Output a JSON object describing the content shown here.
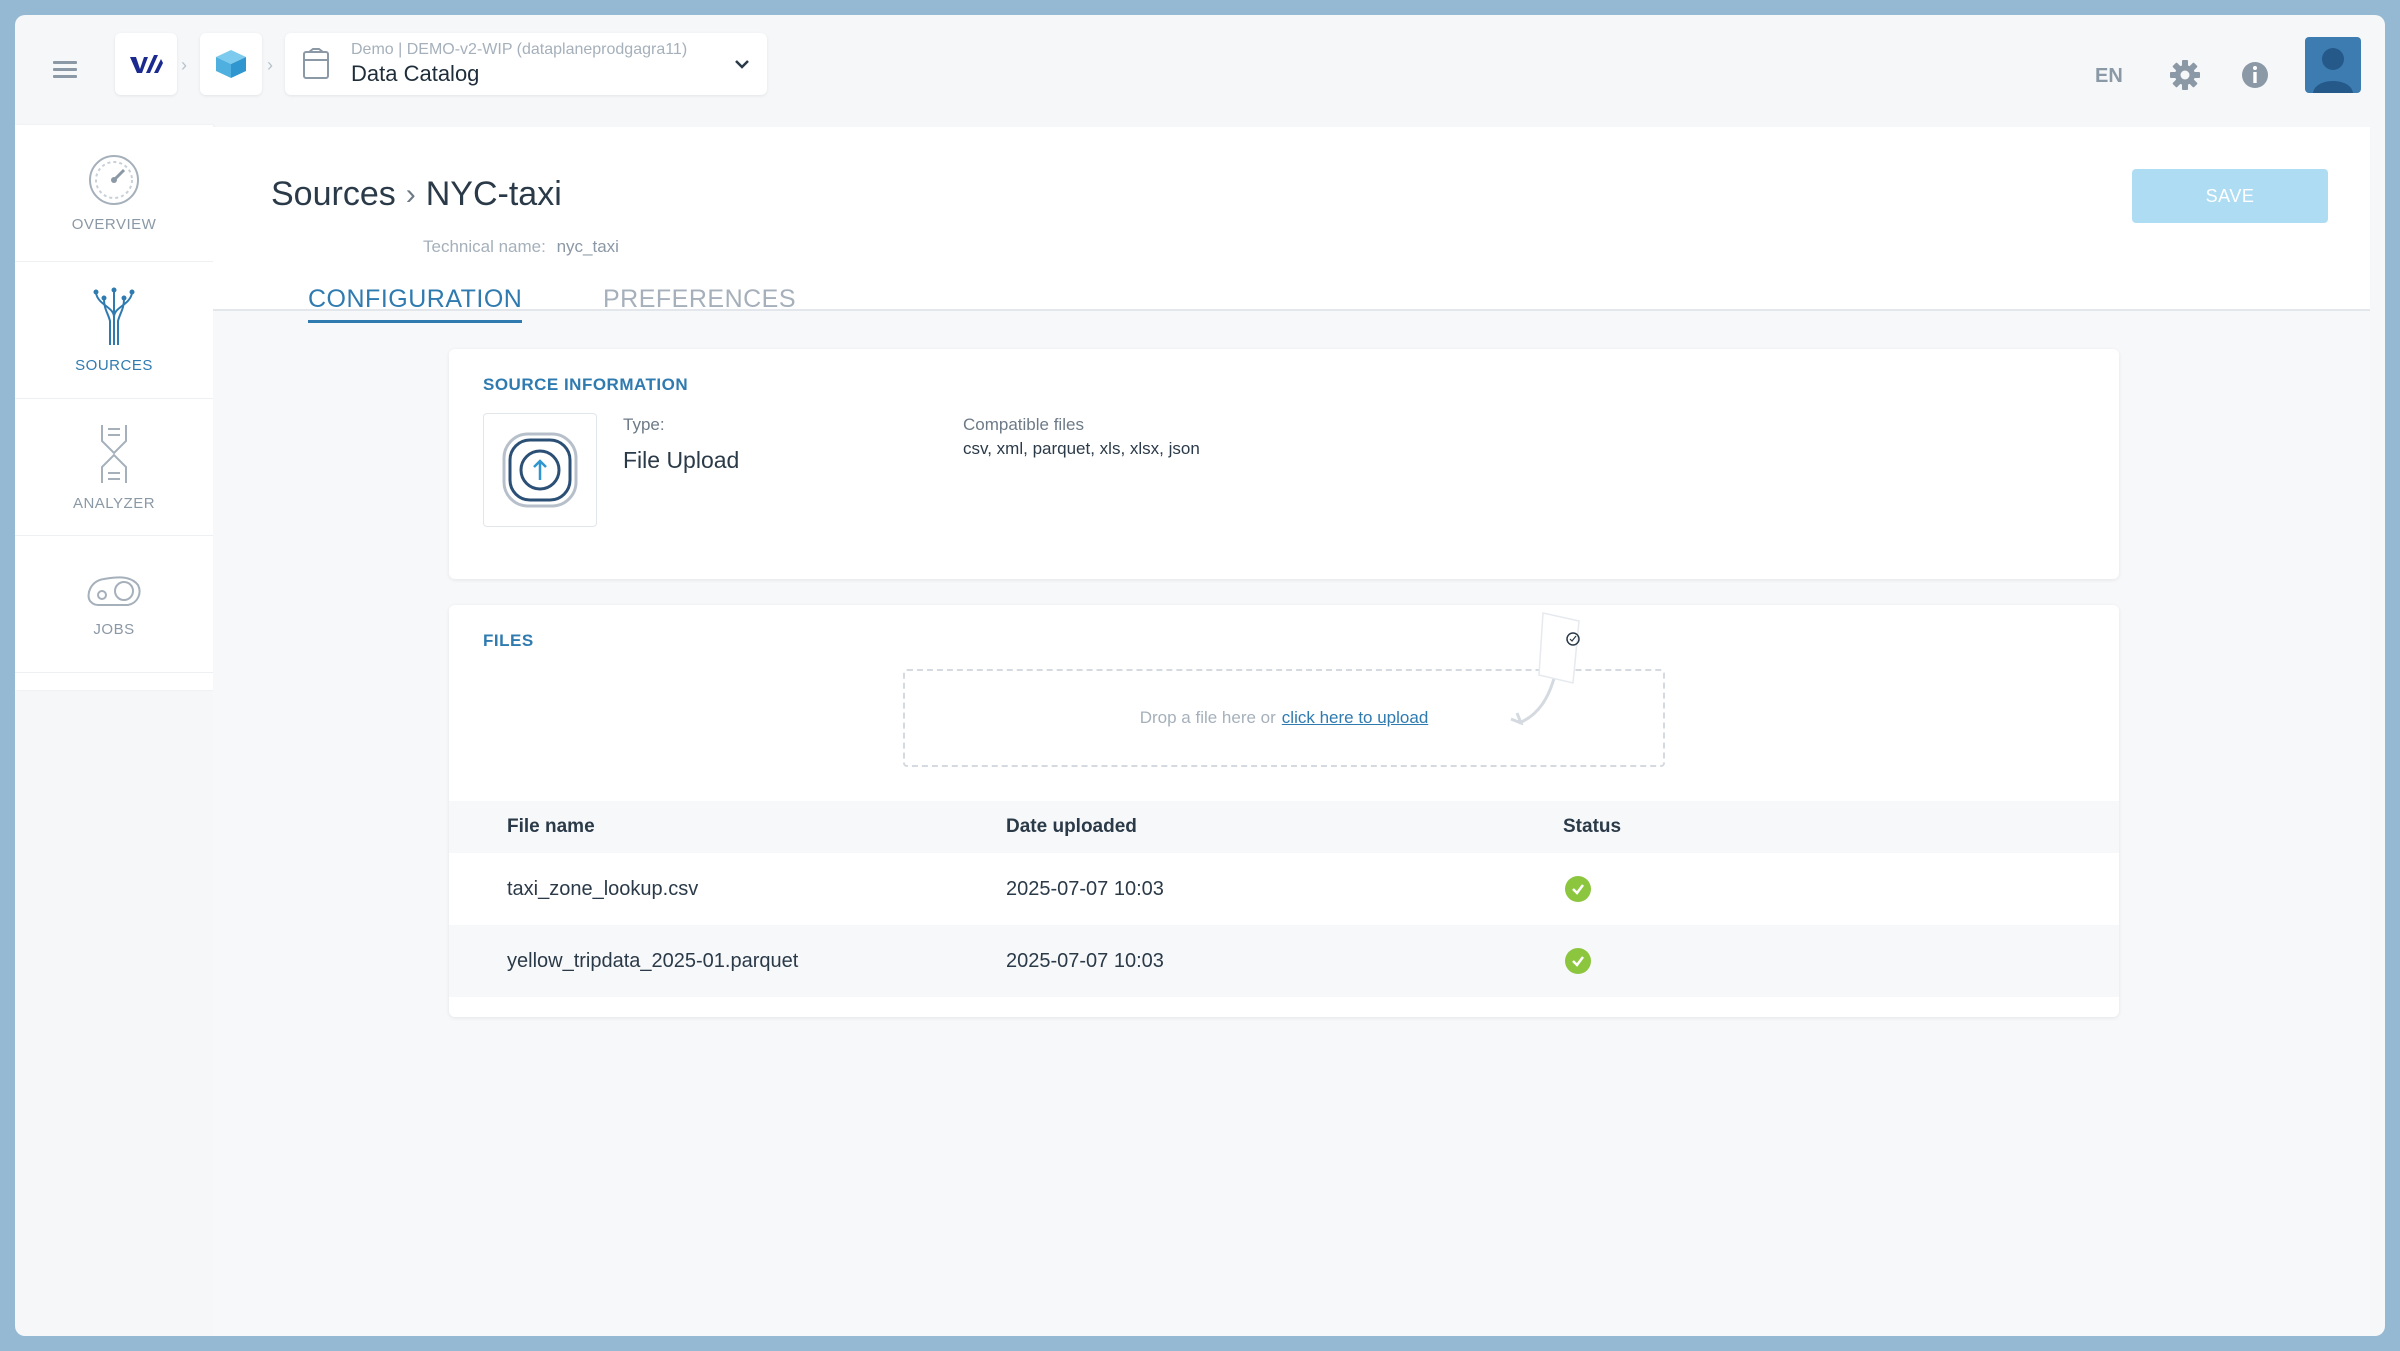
{
  "topbar": {
    "catalog_subtitle": "Demo | DEMO-v2-WIP (dataplaneprodgagra11)",
    "catalog_title": "Data Catalog",
    "language": "EN"
  },
  "sidebar": {
    "items": [
      {
        "label": "OVERVIEW",
        "active": false
      },
      {
        "label": "SOURCES",
        "active": true
      },
      {
        "label": "ANALYZER",
        "active": false
      },
      {
        "label": "JOBS",
        "active": false
      }
    ]
  },
  "header": {
    "breadcrumb_parent": "Sources",
    "breadcrumb_current": "NYC-taxi",
    "technical_name_label": "Technical name:",
    "technical_name_value": "nyc_taxi",
    "save_label": "SAVE",
    "tabs": [
      {
        "label": "CONFIGURATION",
        "active": true
      },
      {
        "label": "PREFERENCES",
        "active": false
      }
    ]
  },
  "source_info": {
    "title": "SOURCE INFORMATION",
    "type_label": "Type:",
    "type_value": "File Upload",
    "compatible_label": "Compatible files",
    "compatible_value": "csv, xml, parquet, xls, xlsx, json"
  },
  "files": {
    "title": "FILES",
    "drop_text": "Drop a file here  or",
    "upload_link": "click here to upload",
    "columns": [
      "File name",
      "Date uploaded",
      "Status"
    ],
    "rows": [
      {
        "name": "taxi_zone_lookup.csv",
        "date": "2025-07-07 10:03",
        "status": "success"
      },
      {
        "name": "yellow_tripdata_2025-01.parquet",
        "date": "2025-07-07 10:03",
        "status": "success"
      }
    ]
  },
  "colors": {
    "accent": "#2f7bb0",
    "save_disabled": "#aeddf3",
    "status_success": "#8cc63f"
  }
}
